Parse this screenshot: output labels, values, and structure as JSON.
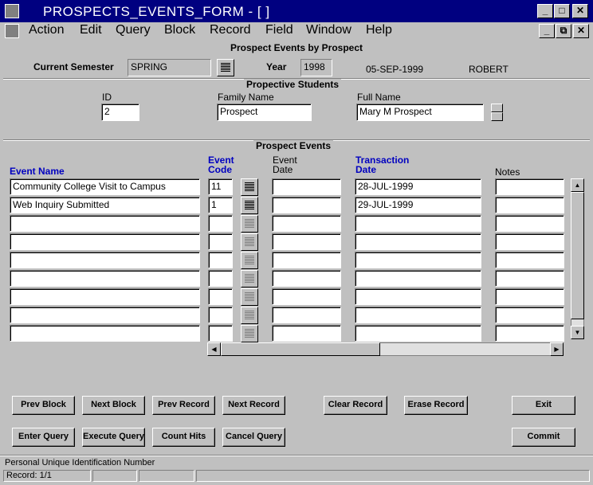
{
  "window": {
    "title": "PROSPECTS_EVENTS_FORM - [ ]",
    "minimize": "_",
    "maximize": "□",
    "close": "✕",
    "restore": "⧉"
  },
  "menu": [
    "Action",
    "Edit",
    "Query",
    "Block",
    "Record",
    "Field",
    "Window",
    "Help"
  ],
  "form": {
    "title": "Prospect Events by Prospect",
    "current_semester_label": "Current Semester",
    "current_semester": "SPRING",
    "year_label": "Year",
    "year": "1998",
    "date": "05-SEP-1999",
    "user": "ROBERT"
  },
  "students": {
    "header": "Propective Students",
    "id_label": "ID",
    "id": "2",
    "family_label": "Family Name",
    "family": "Prospect",
    "full_label": "Full Name",
    "full": "Mary M Prospect"
  },
  "events": {
    "header": "Prospect Events",
    "col_event_name": "Event Name",
    "col_event_code_1": "Event",
    "col_event_code_2": "Code",
    "col_event_date_1": "Event",
    "col_event_date_2": "Date",
    "col_trans_1": "Transaction",
    "col_trans_2": "Date",
    "col_notes": "Notes",
    "rows": [
      {
        "name": "Community College Visit to Campus",
        "code": "11",
        "date": "",
        "trans": "28-JUL-1999",
        "notes": ""
      },
      {
        "name": "Web Inquiry Submitted",
        "code": "1",
        "date": "",
        "trans": "29-JUL-1999",
        "notes": ""
      },
      {
        "name": "",
        "code": "",
        "date": "",
        "trans": "",
        "notes": ""
      },
      {
        "name": "",
        "code": "",
        "date": "",
        "trans": "",
        "notes": ""
      },
      {
        "name": "",
        "code": "",
        "date": "",
        "trans": "",
        "notes": ""
      },
      {
        "name": "",
        "code": "",
        "date": "",
        "trans": "",
        "notes": ""
      },
      {
        "name": "",
        "code": "",
        "date": "",
        "trans": "",
        "notes": ""
      },
      {
        "name": "",
        "code": "",
        "date": "",
        "trans": "",
        "notes": ""
      },
      {
        "name": "",
        "code": "",
        "date": "",
        "trans": "",
        "notes": ""
      }
    ]
  },
  "buttons": {
    "prev_block": "Prev Block",
    "next_block": "Next Block",
    "prev_record": "Prev Record",
    "next_record": "Next Record",
    "clear_record": "Clear Record",
    "erase_record": "Erase Record",
    "exit": "Exit",
    "enter_query": "Enter Query",
    "execute_query": "Execute Query",
    "count_hits": "Count Hits",
    "cancel_query": "Cancel Query",
    "commit": "Commit"
  },
  "status": {
    "hint": "Personal Unique Identification Number",
    "record": "Record: 1/1"
  }
}
